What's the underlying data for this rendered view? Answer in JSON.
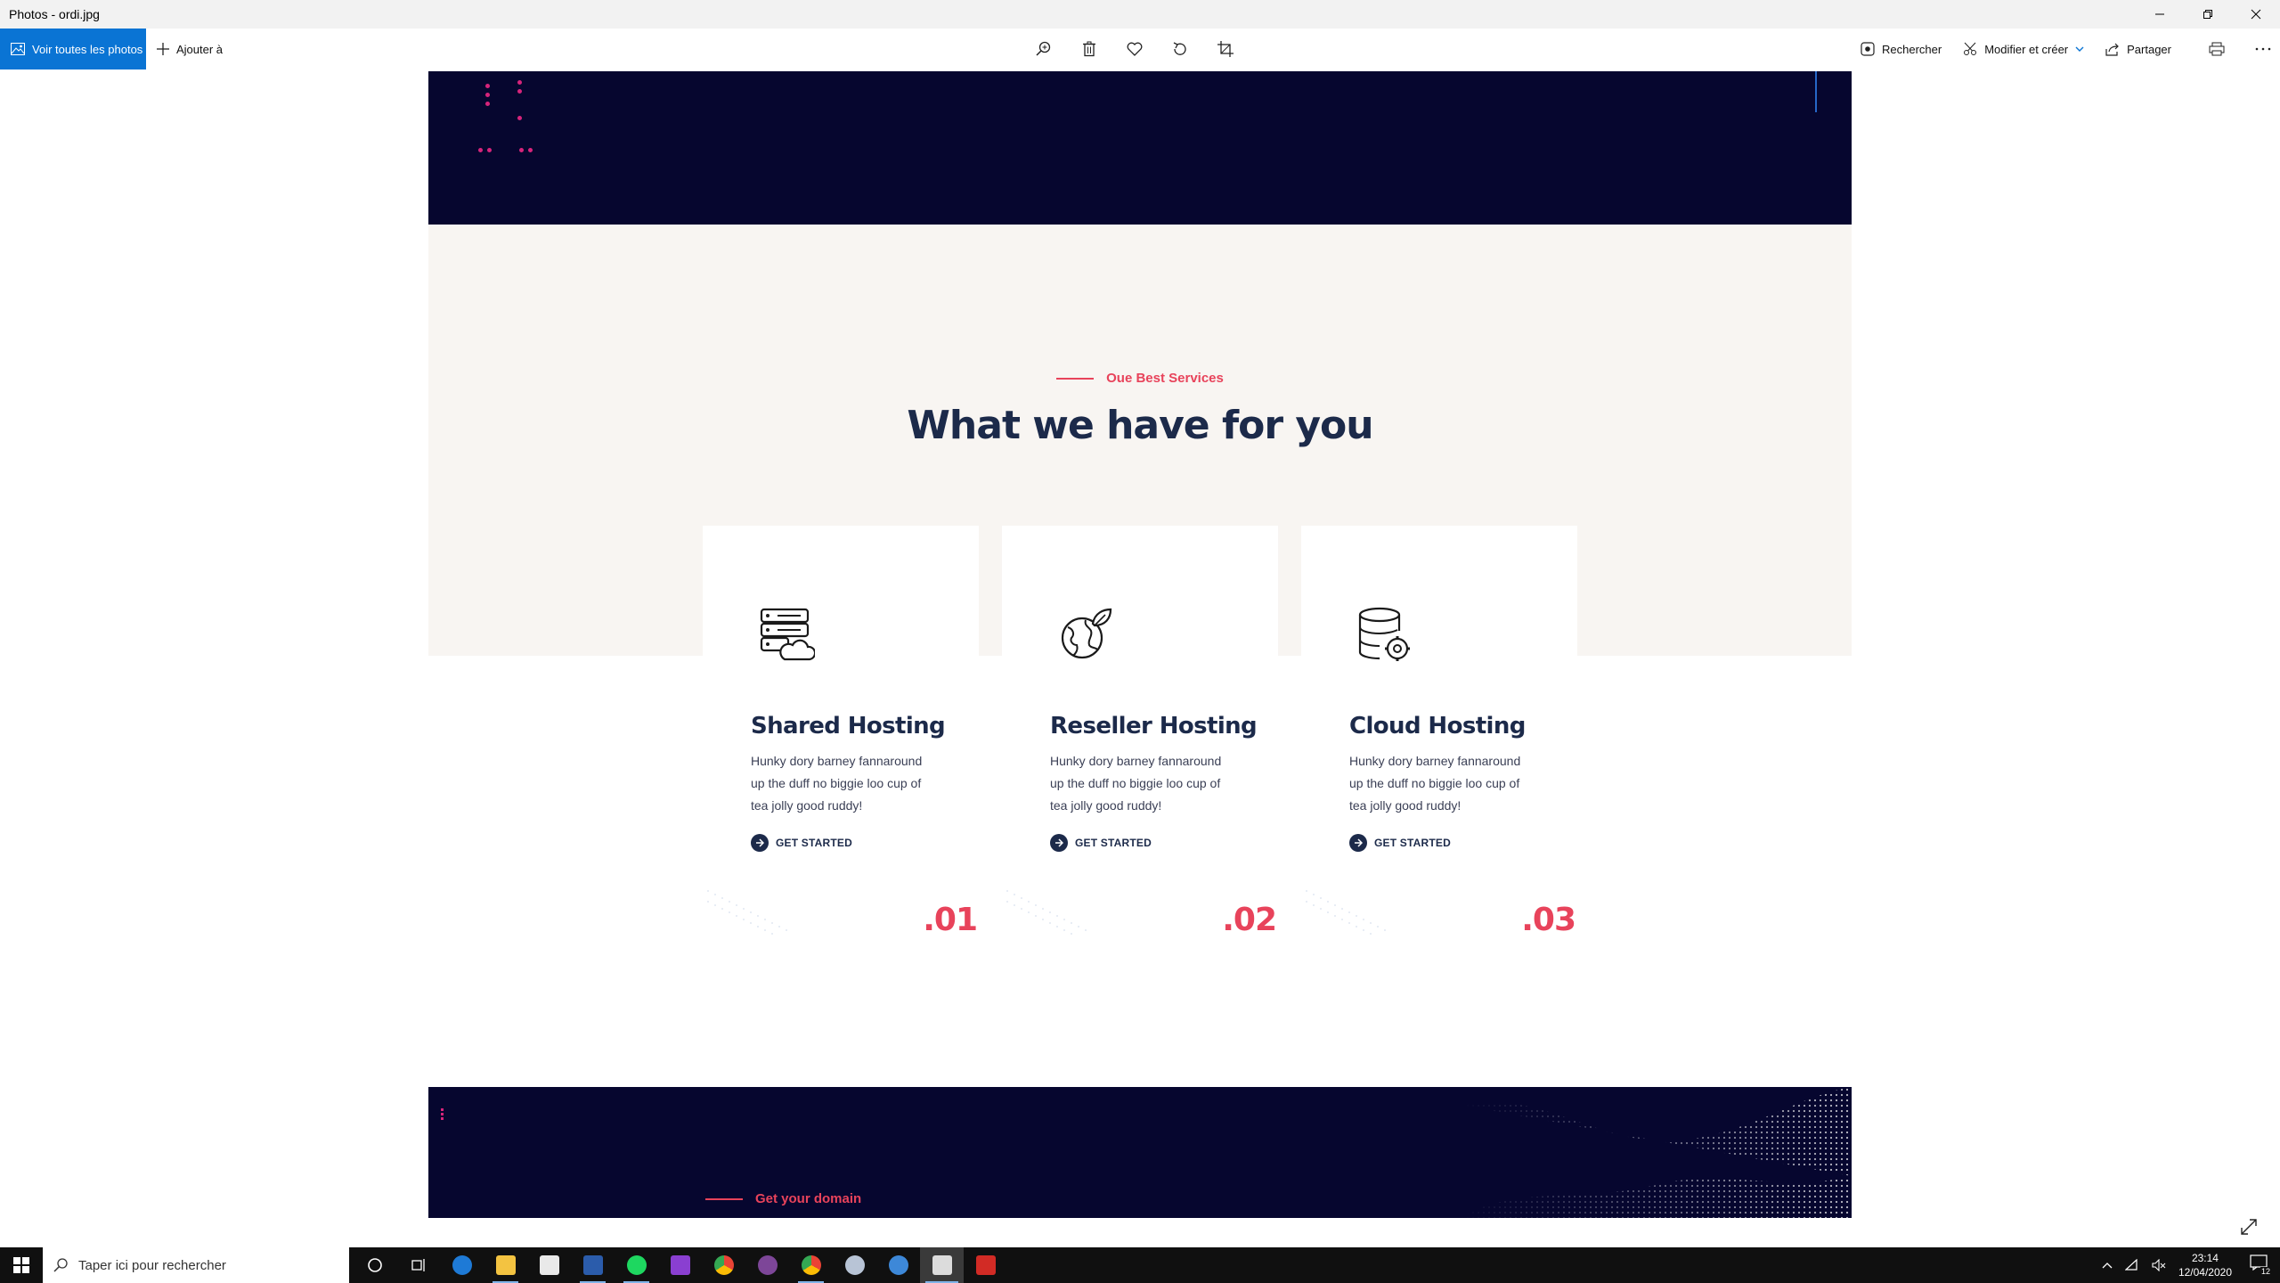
{
  "window": {
    "title": "Photos - ordi.jpg"
  },
  "toolbar": {
    "all_photos": "Voir toutes les photos",
    "add_to": "Ajouter à",
    "search": "Rechercher",
    "edit_create": "Modifier et créer",
    "share": "Partager"
  },
  "photo": {
    "eyebrow": "Oue Best Services",
    "heading": "What we have for you",
    "cards": [
      {
        "title": "Shared Hosting",
        "text": "Hunky dory barney fannaround up the duff no biggie loo cup of tea jolly good ruddy!",
        "link": "GET STARTED",
        "num": ".01",
        "icon": "server-cloud-icon"
      },
      {
        "title": "Reseller Hosting",
        "text": "Hunky dory barney fannaround up the duff no biggie loo cup of tea jolly good ruddy!",
        "link": "GET STARTED",
        "num": ".02",
        "icon": "eco-globe-icon"
      },
      {
        "title": "Cloud Hosting",
        "text": "Hunky dory barney fannaround up the duff no biggie loo cup of tea jolly good ruddy!",
        "link": "GET STARTED",
        "num": ".03",
        "icon": "database-gear-icon"
      }
    ],
    "domain": "Get your domain",
    "colors": {
      "navy": "#06062f",
      "accent": "#e8435b",
      "heading": "#1c2a4a",
      "light_bg": "#f8f5f2"
    }
  },
  "taskbar": {
    "search_placeholder": "Taper ici pour rechercher",
    "time": "23:14",
    "date": "12/04/2020",
    "notifications": "12"
  }
}
